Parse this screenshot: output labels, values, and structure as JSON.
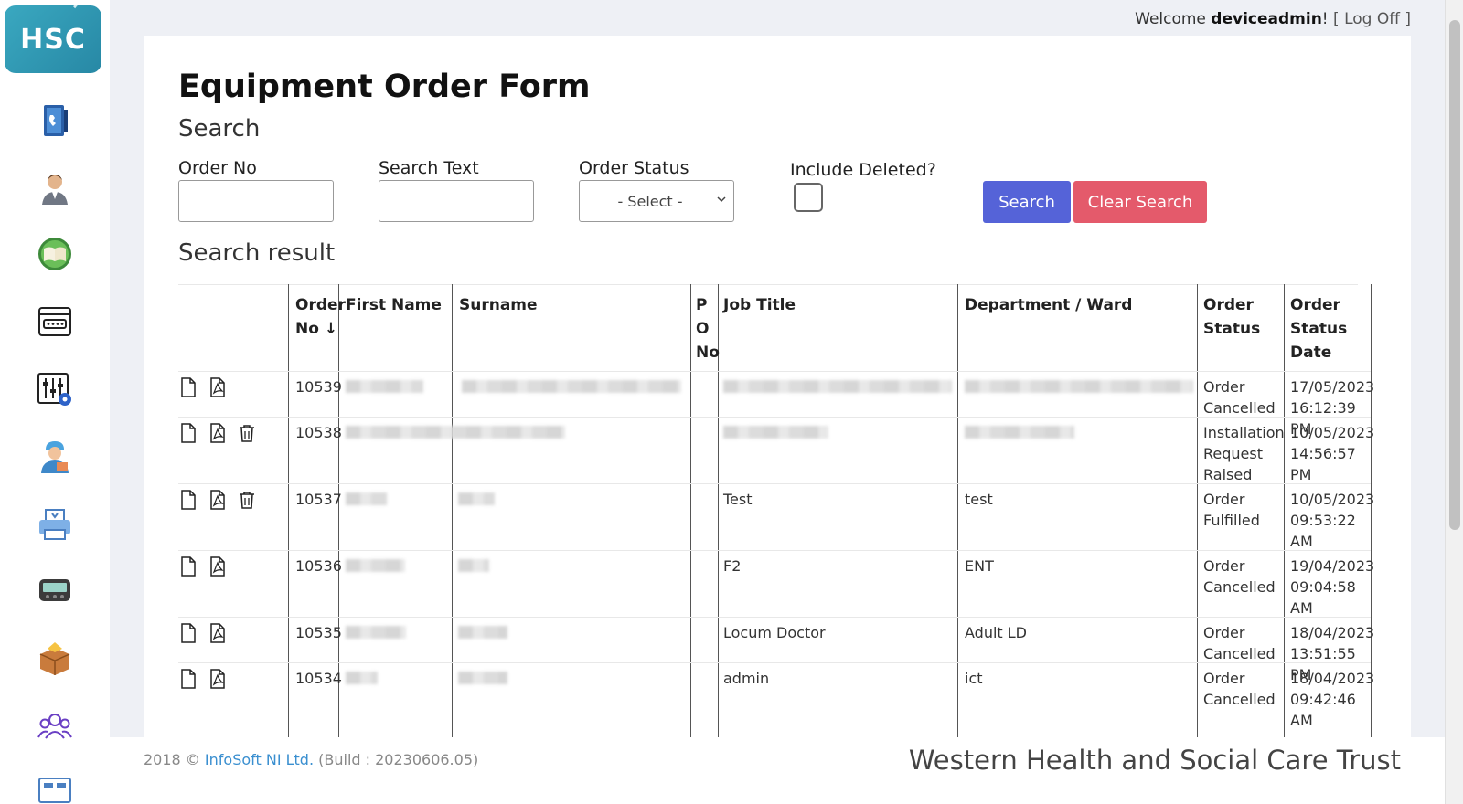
{
  "header": {
    "welcome_prefix": "Welcome",
    "username": "deviceadmin",
    "exclaim": "!",
    "bracket_open": "[",
    "logoff_label": "Log Off",
    "bracket_close": "]"
  },
  "sidebar": {
    "logo_text": "HSC",
    "items": [
      {
        "name": "phone-directory-icon"
      },
      {
        "name": "user-icon"
      },
      {
        "name": "book-icon"
      },
      {
        "name": "password-window-icon"
      },
      {
        "name": "settings-panel-icon"
      },
      {
        "name": "engineer-icon"
      },
      {
        "name": "printer-icon"
      },
      {
        "name": "pager-icon"
      },
      {
        "name": "package-icon"
      },
      {
        "name": "group-icon"
      },
      {
        "name": "card-icon"
      }
    ]
  },
  "page": {
    "title": "Equipment Order Form",
    "search_heading": "Search",
    "result_heading": "Search result"
  },
  "search": {
    "order_no_label": "Order No",
    "order_no_value": "",
    "search_text_label": "Search Text",
    "search_text_value": "",
    "order_status_label": "Order Status",
    "order_status_selected": "- Select -",
    "include_deleted_label": "Include Deleted?",
    "include_deleted_checked": false,
    "search_button": "Search",
    "clear_button": "Clear Search"
  },
  "table": {
    "headers": {
      "order_no": "Order No",
      "sort_arrow": "↓",
      "first_name": "First Name",
      "surname": "Surname",
      "po_no": "PO No",
      "job_title": "Job Title",
      "department": "Department / Ward",
      "order_status": "Order Status",
      "order_status_date": "Order Status Date"
    },
    "rows": [
      {
        "order_no": "10539",
        "job_title": "",
        "department": "",
        "status": "Order Cancelled",
        "date": "17/05/2023 16:12:39 PM",
        "deletable": false
      },
      {
        "order_no": "10538",
        "job_title": "",
        "department": "",
        "status": "Installation Request Raised",
        "date": "10/05/2023 14:56:57 PM",
        "deletable": true
      },
      {
        "order_no": "10537",
        "job_title": "Test",
        "department": "test",
        "status": "Order Fulfilled",
        "date": "10/05/2023 09:53:22 AM",
        "deletable": true
      },
      {
        "order_no": "10536",
        "job_title": "F2",
        "department": "ENT",
        "status": "Order Cancelled",
        "date": "19/04/2023 09:04:58 AM",
        "deletable": false
      },
      {
        "order_no": "10535",
        "job_title": "Locum Doctor",
        "department": "Adult LD",
        "status": "Order Cancelled",
        "date": "18/04/2023 13:51:55 PM",
        "deletable": false
      },
      {
        "order_no": "10534",
        "job_title": "admin",
        "department": "ict",
        "status": "Order Cancelled",
        "date": "18/04/2023 09:42:46 AM",
        "deletable": false
      }
    ]
  },
  "footer": {
    "copyright_prefix": "2018 ©",
    "company_link": "InfoSoft NI Ltd.",
    "build": "(Build : 20230606.05)",
    "trust_name": "Western Health and Social Care Trust"
  },
  "colors": {
    "search_button": "#5563d8",
    "clear_button": "#e45a6b",
    "link": "#3a8fd0"
  }
}
